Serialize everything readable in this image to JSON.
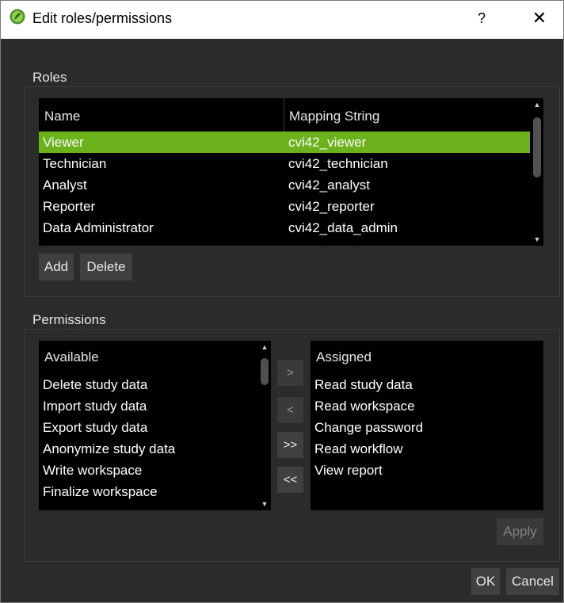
{
  "window": {
    "title": "Edit roles/permissions",
    "help_label": "?",
    "close_label": "✕",
    "icon": "app-logo-icon"
  },
  "roles": {
    "section_title": "Roles",
    "columns": [
      "Name",
      "Mapping String"
    ],
    "rows": [
      {
        "name": "Viewer",
        "mapping": "cvi42_viewer",
        "selected": true
      },
      {
        "name": "Technician",
        "mapping": "cvi42_technician",
        "selected": false
      },
      {
        "name": "Analyst",
        "mapping": "cvi42_analyst",
        "selected": false
      },
      {
        "name": "Reporter",
        "mapping": "cvi42_reporter",
        "selected": false
      },
      {
        "name": "Data Administrator",
        "mapping": "cvi42_data_admin",
        "selected": false
      }
    ],
    "add_label": "Add",
    "delete_label": "Delete",
    "selected_color": "#6cb21c"
  },
  "permissions": {
    "section_title": "Permissions",
    "available_header": "Available",
    "available": [
      "Delete study data",
      "Import study data",
      "Export study data",
      "Anonymize study data",
      "Write workspace",
      "Finalize workspace"
    ],
    "assigned_header": "Assigned",
    "assigned": [
      "Read study data",
      "Read workspace",
      "Change password",
      "Read workflow",
      "View report"
    ],
    "assign_one_label": ">",
    "unassign_one_label": "<",
    "assign_all_label": ">>",
    "unassign_all_label": "<<",
    "apply_label": "Apply"
  },
  "footer": {
    "ok_label": "OK",
    "cancel_label": "Cancel"
  }
}
